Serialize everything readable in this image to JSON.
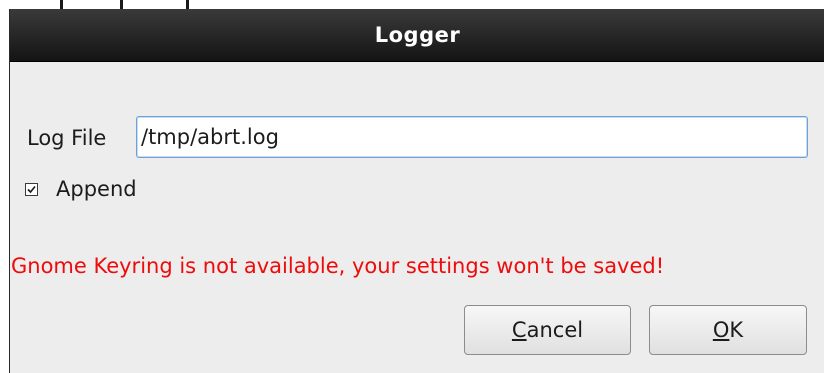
{
  "window": {
    "title": "Logger"
  },
  "form": {
    "log_file_label": "Log File",
    "log_file_value": "/tmp/abrt.log",
    "append_label": "Append",
    "append_checked": true
  },
  "warning": {
    "text": "Gnome Keyring is not available, your settings won't be saved!",
    "color": "#ee0b0b"
  },
  "buttons": {
    "cancel": {
      "mnemonic": "C",
      "rest": "ancel"
    },
    "ok": {
      "mnemonic": "O",
      "rest": "K"
    }
  },
  "icons": {
    "append_checkbox": "checkmark-icon"
  }
}
